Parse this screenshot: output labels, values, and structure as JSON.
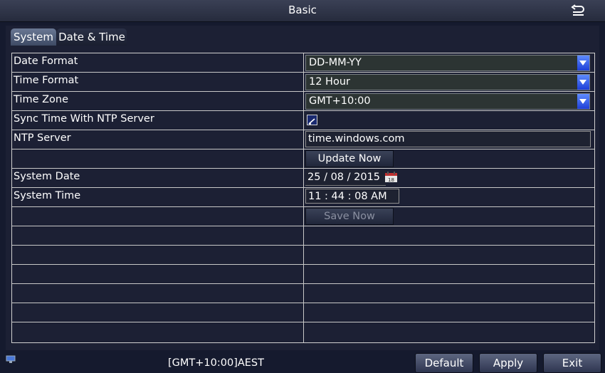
{
  "window": {
    "title": "Basic"
  },
  "tabs": [
    {
      "label": "System",
      "active": true
    },
    {
      "label": "Date & Time",
      "active": false
    }
  ],
  "form": {
    "date_format": {
      "label": "Date Format",
      "value": "DD-MM-YY"
    },
    "time_format": {
      "label": "Time Format",
      "value": "12 Hour"
    },
    "time_zone": {
      "label": "Time Zone",
      "value": "GMT+10:00"
    },
    "ntp_sync": {
      "label": "Sync Time With NTP Server",
      "checked": true
    },
    "ntp_server": {
      "label": "NTP Server",
      "value": "time.windows.com"
    },
    "update_now": {
      "label": "Update Now"
    },
    "system_date": {
      "label": "System Date",
      "day": "25",
      "month": "08",
      "year": "2015",
      "sep": "/"
    },
    "system_time": {
      "label": "System Time",
      "value": "11 : 44 : 08 AM"
    },
    "save_now": {
      "label": "Save Now"
    }
  },
  "footer": {
    "status": "[GMT+10:00]AEST",
    "default_label": "Default",
    "apply_label": "Apply",
    "exit_label": "Exit"
  },
  "icons": {
    "back": "back-arrow-icon",
    "dropdown": "chevron-down-icon",
    "calendar": "calendar-icon",
    "network": "network-icon"
  },
  "colors": {
    "dropdown_accent": "#2e5bff",
    "background": "#1c2034"
  }
}
